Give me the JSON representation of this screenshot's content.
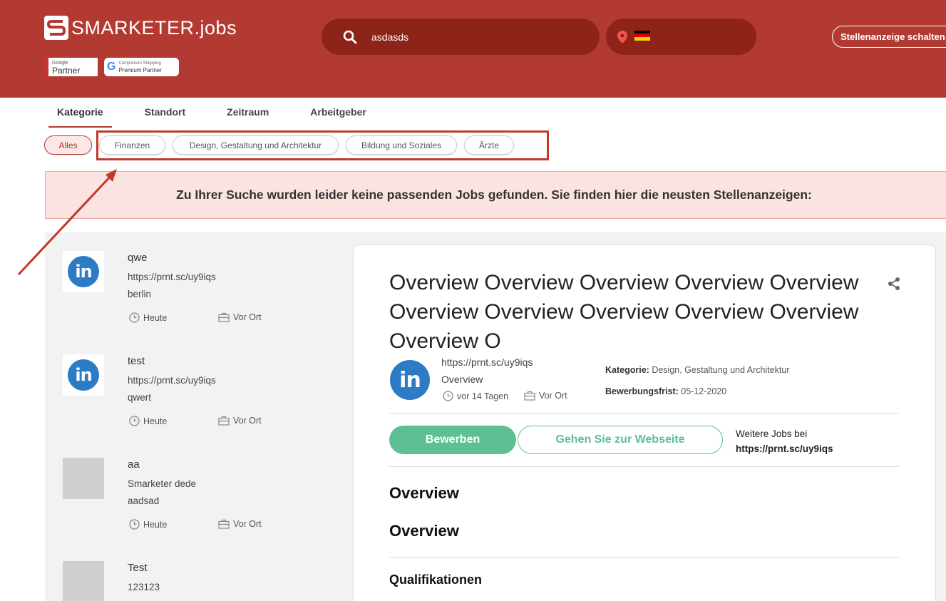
{
  "header": {
    "brand": "SMARKETER",
    "tld": ".jobs",
    "badge_google_small": "Google",
    "badge_google_big": "Partner",
    "badge_css_small": "Comparison Shopping",
    "badge_css_big": "Premium Partner",
    "search_value": "asdasds",
    "post_button": "Stellenanzeige schalten"
  },
  "tabs": [
    "Kategorie",
    "Standort",
    "Zeitraum",
    "Arbeitgeber"
  ],
  "chips": [
    "Alles",
    "Finanzen",
    "Design, Gestaltung und Architektur",
    "Bildung und Soziales",
    "Ärzte"
  ],
  "notice": "Zu Ihrer Suche wurden leider keine passenden Jobs gefunden. Sie finden hier die neusten Stellenanzeigen:",
  "jobs": [
    {
      "title": "qwe",
      "line1": "https://prnt.sc/uy9iqs",
      "line2": "berlin",
      "date": "Heute",
      "type": "Vor Ort",
      "logo": "linkedin"
    },
    {
      "title": "test",
      "line1": "https://prnt.sc/uy9iqs",
      "line2": "qwert",
      "date": "Heute",
      "type": "Vor Ort",
      "logo": "linkedin"
    },
    {
      "title": "aa",
      "line1": "Smarketer dede",
      "line2": "aadsad",
      "date": "Heute",
      "type": "Vor Ort",
      "logo": "placeholder"
    },
    {
      "title": "Test",
      "line1": "123123",
      "line2": "",
      "date": "",
      "type": "",
      "logo": "placeholder"
    }
  ],
  "detail": {
    "title": "Overview Overview Overview Overview Overview Overview Overview Overview Overview Overview Overview O",
    "company_url": "https://prnt.sc/uy9iqs",
    "company_line2": "Overview",
    "posted": "vor 14 Tagen",
    "type": "Vor Ort",
    "category_label": "Kategorie:",
    "category_value": "Design, Gestaltung und Architektur",
    "deadline_label": "Bewerbungsfrist:",
    "deadline_value": "05-12-2020",
    "apply_button": "Bewerben",
    "website_button": "Gehen Sie zur Webseite",
    "more_jobs_label": "Weitere Jobs bei",
    "more_jobs_link": "https://prnt.sc/uy9iqs",
    "heading1": "Overview",
    "heading2": "Overview",
    "subheading": "Qualifikationen"
  },
  "colors": {
    "header_bg": "#b33a32",
    "search_bg": "#8e2319",
    "accent_green": "#5cc094",
    "annotation_red": "#c0392b"
  }
}
